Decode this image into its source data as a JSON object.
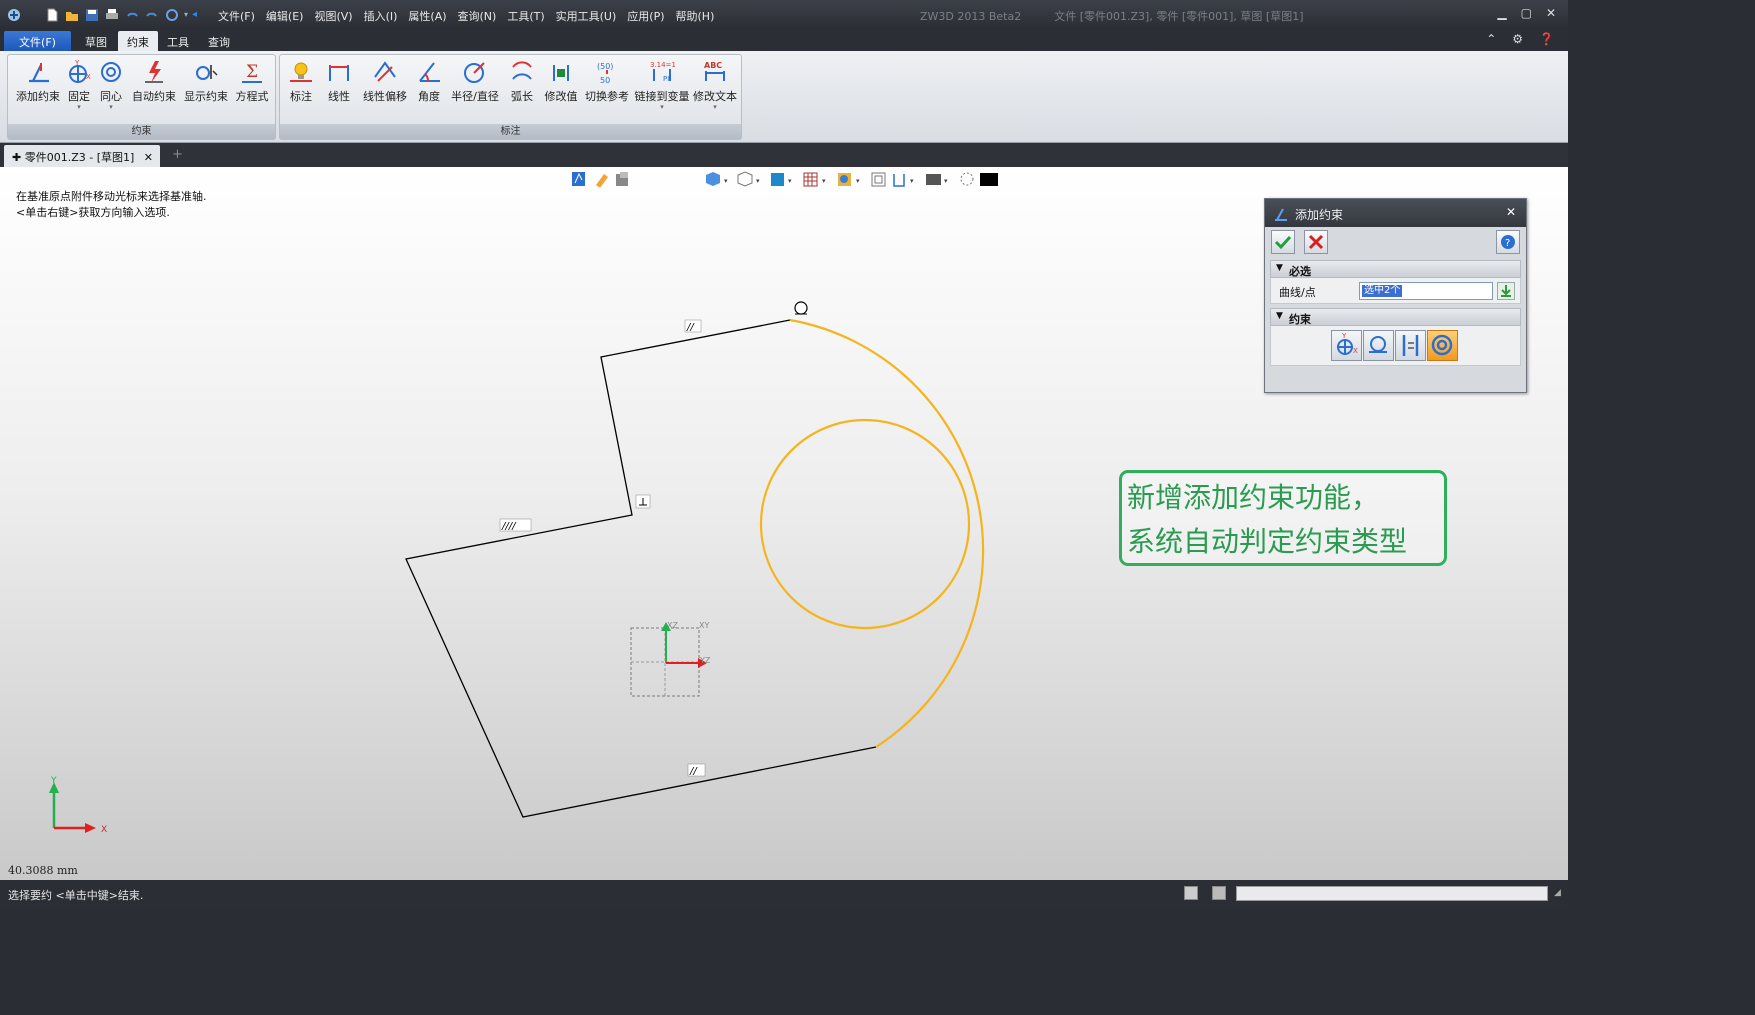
{
  "titlebar": {
    "menus": [
      "文件(F)",
      "编辑(E)",
      "视图(V)",
      "插入(I)",
      "属性(A)",
      "查询(N)",
      "工具(T)",
      "实用工具(U)",
      "应用(P)",
      "帮助(H)"
    ],
    "app_title": "ZW3D 2013 Beta2",
    "doc_title": "文件 [零件001.Z3], 零件 [零件001], 草图 [草图1]"
  },
  "ribbon_tabs": {
    "file": "文件(F)",
    "sketch": "草图",
    "constraint": "约束",
    "tools": "工具",
    "query": "查询"
  },
  "ribbon": {
    "group_constraint": {
      "label": "约束",
      "buttons": [
        "添加约束",
        "固定",
        "同心",
        "自动约束",
        "显示约束",
        "方程式"
      ]
    },
    "group_dimension": {
      "label": "标注",
      "buttons": [
        "标注",
        "线性",
        "线性偏移",
        "角度",
        "半径/直径",
        "弧长",
        "修改值",
        "切换参考",
        "链接到变量",
        "修改文本"
      ]
    }
  },
  "doc_tab": {
    "label": "零件001.Z3 - [草图1]"
  },
  "canvas": {
    "hint_line1": "在基准原点附件移动光标来选择基准轴.",
    "hint_line2": "<单击右键>获取方向输入选项.",
    "distance": "40.3088 mm",
    "axis_x": "X",
    "axis_y": "Y",
    "axis_xz": "XZ",
    "axis_xy": "XY",
    "axis_yz": "YZ"
  },
  "dialog": {
    "title": "添加约束",
    "section_required": "必选",
    "field_label": "曲线/点",
    "field_value": "选中2个",
    "section_constraint": "约束"
  },
  "callout": {
    "line1": "新增添加约束功能，",
    "line2": "系统自动判定约束类型"
  },
  "status": {
    "text": "选择要约 <单击中键>结束."
  },
  "colors": {
    "selected_curve": "#f5b41e",
    "sketch_line": "#000000",
    "callout": "#2fae5b",
    "file_tab": "#2a66c8"
  }
}
